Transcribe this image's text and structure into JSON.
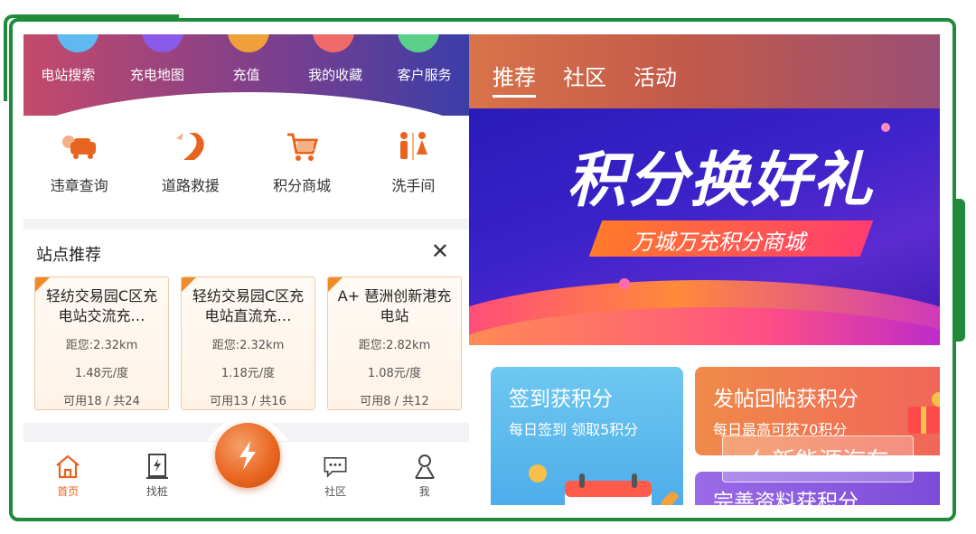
{
  "quick_nav": [
    {
      "label": "电站搜索",
      "color": "#5fb8f0"
    },
    {
      "label": "充电地图",
      "color": "#8a5ae8"
    },
    {
      "label": "充值",
      "color": "#f0a03a"
    },
    {
      "label": "我的收藏",
      "color": "#f06a6a"
    },
    {
      "label": "客户服务",
      "color": "#5ad08a"
    }
  ],
  "services": [
    {
      "label": "违章查询",
      "icon": "car-violation-icon"
    },
    {
      "label": "道路救援",
      "icon": "road-rescue-icon"
    },
    {
      "label": "积分商城",
      "icon": "shopping-cart-icon"
    },
    {
      "label": "洗手间",
      "icon": "restroom-icon"
    }
  ],
  "recommend": {
    "title": "站点推荐",
    "close": "✕",
    "cards": [
      {
        "name": "轻纺交易园C区充电站交流充…",
        "distance": "距您:2.32km",
        "price": "1.48元/度",
        "availability": "可用18 / 共24"
      },
      {
        "name": "轻纺交易园C区充电站直流充…",
        "distance": "距您:2.32km",
        "price": "1.18元/度",
        "availability": "可用13 / 共16"
      },
      {
        "name": "A+ 琶洲创新港充电站",
        "distance": "距您:2.82km",
        "price": "1.08元/度",
        "availability": "可用8 / 共12"
      }
    ]
  },
  "tabbar": [
    {
      "label": "首页",
      "icon": "home-icon",
      "active": true
    },
    {
      "label": "找桩",
      "icon": "charger-icon",
      "active": false
    },
    {
      "label": "社区",
      "icon": "chat-icon",
      "active": false
    },
    {
      "label": "我",
      "icon": "profile-icon",
      "active": false
    }
  ],
  "fab_icon": "lightning-icon",
  "right_tabs": [
    {
      "label": "推荐",
      "active": true
    },
    {
      "label": "社区",
      "active": false
    },
    {
      "label": "活动",
      "active": false
    }
  ],
  "promo": {
    "headline": "积分换好礼",
    "subline": "万城万充积分商城"
  },
  "tiles": [
    {
      "title": "签到获积分",
      "subtitle": "每日签到 领取5积分"
    },
    {
      "title": "发帖回帖获积分",
      "subtitle": "每日最高可获70积分"
    },
    {
      "title": "完善资料获积分",
      "subtitle": ""
    }
  ],
  "watermark": "新能源汽车",
  "colors": {
    "accent": "#e8641e",
    "frame": "#1f8a3b"
  }
}
